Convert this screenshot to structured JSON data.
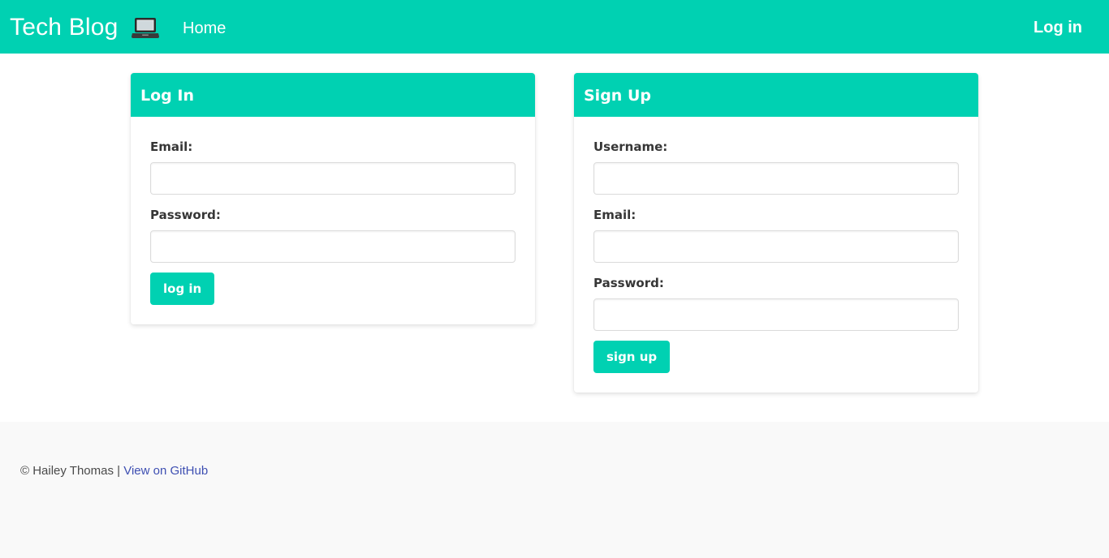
{
  "navbar": {
    "brand": "Tech Blog",
    "brand_icon": "laptop-icon",
    "home_label": "Home",
    "login_label": "Log in"
  },
  "login_card": {
    "title": "Log In",
    "email_label": "Email:",
    "email_value": "",
    "password_label": "Password:",
    "password_value": "",
    "button_label": "log in"
  },
  "signup_card": {
    "title": "Sign Up",
    "username_label": "Username:",
    "username_value": "",
    "email_label": "Email:",
    "email_value": "",
    "password_label": "Password:",
    "password_value": "",
    "button_label": "sign up"
  },
  "footer": {
    "copyright": "© Hailey Thomas",
    "separator": "|",
    "github_link": "View on GitHub"
  },
  "colors": {
    "accent": "#00d1b2",
    "link": "#3e4fb2",
    "footer_bg": "#f9f9f9"
  }
}
